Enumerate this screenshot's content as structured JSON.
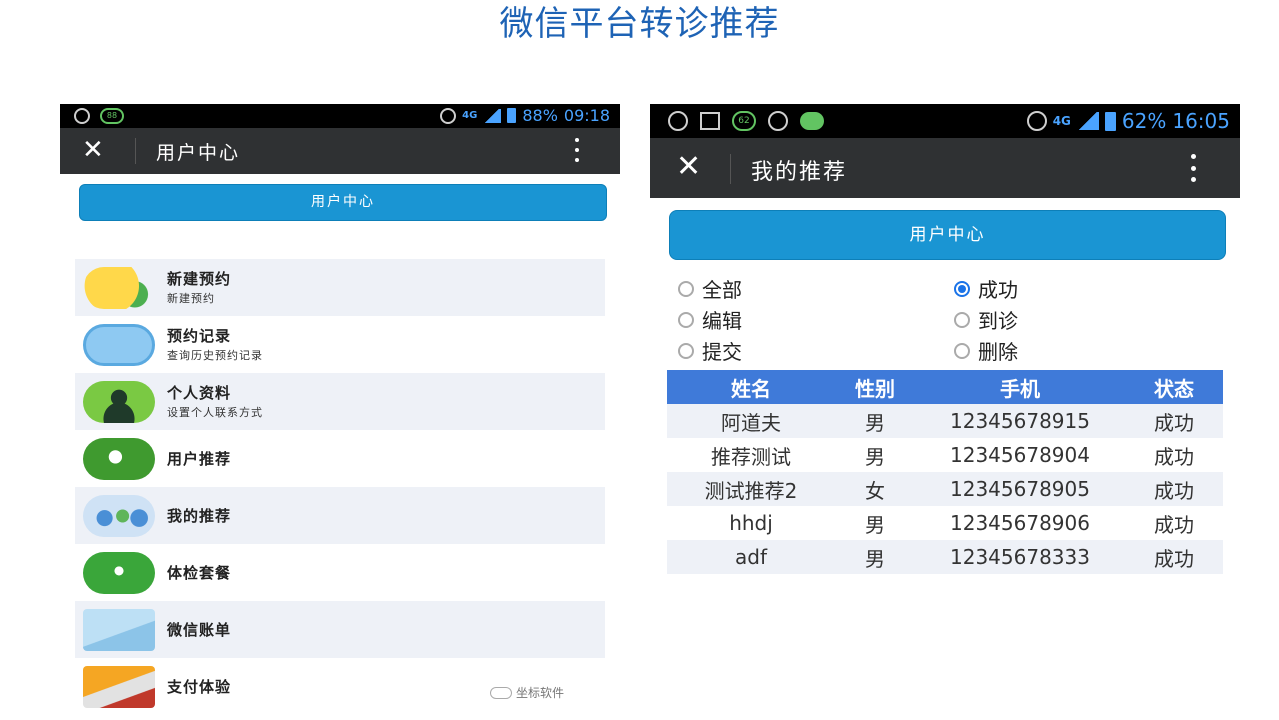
{
  "slide": {
    "title": "微信平台转诊推荐"
  },
  "phone1": {
    "status": {
      "battery": "88%",
      "time": "09:18",
      "network": "4G",
      "badge": "88"
    },
    "appbar": {
      "title": "用户中心"
    },
    "user_center_button": "用户中心",
    "menu": [
      {
        "title": "新建预约",
        "subtitle": "新建预约",
        "icon": "smiley-add-icon"
      },
      {
        "title": "预约记录",
        "subtitle": "查询历史预约记录",
        "icon": "cloud-document-icon"
      },
      {
        "title": "个人资料",
        "subtitle": "设置个人联系方式",
        "icon": "person-icon"
      },
      {
        "title": "用户推荐",
        "subtitle": "",
        "icon": "user-add-icon"
      },
      {
        "title": "我的推荐",
        "subtitle": "",
        "icon": "group-icon"
      },
      {
        "title": "体检套餐",
        "subtitle": "",
        "icon": "runner-icon"
      },
      {
        "title": "微信账单",
        "subtitle": "",
        "icon": "bill-icon"
      },
      {
        "title": "支付体验",
        "subtitle": "",
        "icon": "credit-card-icon"
      }
    ],
    "watermark": "坐标软件"
  },
  "phone2": {
    "status": {
      "battery": "62%",
      "time": "16:05",
      "network": "4G",
      "badge": "62"
    },
    "appbar": {
      "title": "我的推荐"
    },
    "user_center_button": "用户中心",
    "filters": [
      {
        "label": "全部",
        "selected": false
      },
      {
        "label": "成功",
        "selected": true
      },
      {
        "label": "编辑",
        "selected": false
      },
      {
        "label": "到诊",
        "selected": false
      },
      {
        "label": "提交",
        "selected": false
      },
      {
        "label": "删除",
        "selected": false
      }
    ],
    "table": {
      "headers": [
        "姓名",
        "性别",
        "手机",
        "状态"
      ],
      "rows": [
        [
          "阿道夫",
          "男",
          "12345678915",
          "成功"
        ],
        [
          "推荐测试",
          "男",
          "12345678904",
          "成功"
        ],
        [
          "测试推荐2",
          "女",
          "12345678905",
          "成功"
        ],
        [
          "hhdj",
          "男",
          "12345678906",
          "成功"
        ],
        [
          "adf",
          "男",
          "12345678333",
          "成功"
        ]
      ]
    }
  }
}
